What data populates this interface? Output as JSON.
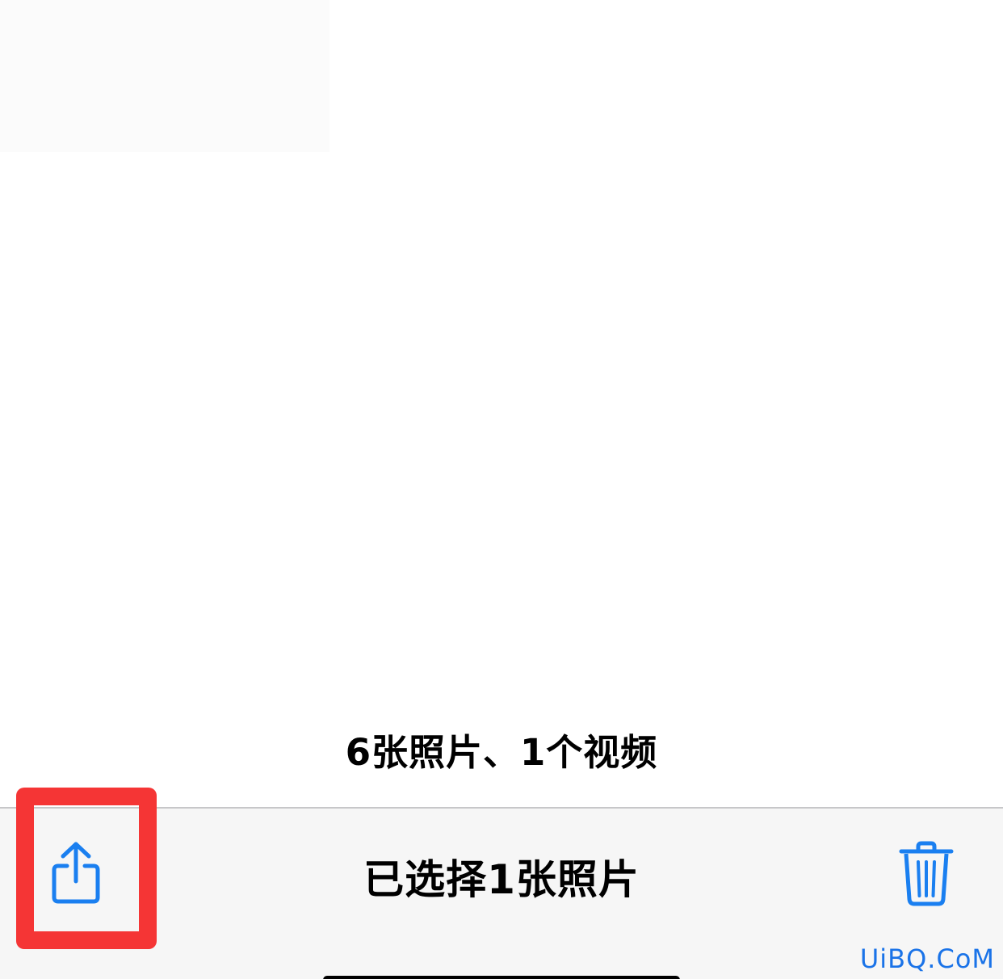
{
  "library": {
    "count_label": "6张照片、1个视频"
  },
  "toolbar": {
    "title": "已选择1张照片",
    "share_icon": "share-icon",
    "trash_icon": "trash-icon",
    "accent_color": "#1a7ff0"
  },
  "annotation": {
    "highlight_color": "#f53535"
  },
  "watermark": {
    "text": "UiBQ.CoM"
  }
}
